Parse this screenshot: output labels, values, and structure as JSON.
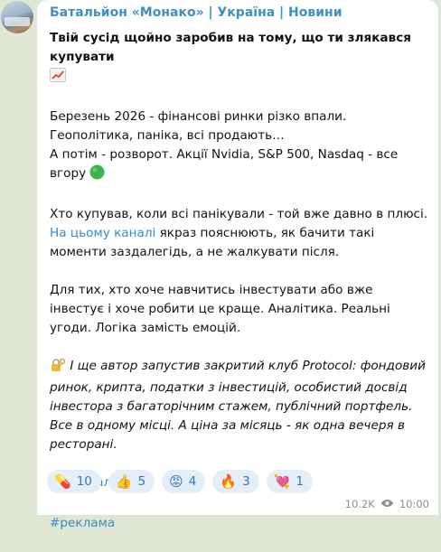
{
  "channel": {
    "name": "Батальйон «Монако» | Україна | Новини"
  },
  "post": {
    "headline": "Твій сусід щойно заробив на тому, що ти злякався купувати",
    "p1_line1": "Березень 2026 - фінансові ринки різко впали. Геополітика, паніка, всі продають…",
    "p1_line2": "А потім - розворот. Акції Nvidia, S&P 500, Nasdaq - все вгору",
    "p2_line1": "Хто купував, коли всі панікували - той вже давно в плюсі.",
    "p2_link": "На цьому каналі",
    "p2_rest": " якраз пояснюють, як бачити такі моменти заздалегідь, а не жалкувати після.",
    "p3": "Для тих, хто хоче навчитись інвестувати або вже інвестує і хоче робити це краще. Аналітика. Реальні угоди. Логіка замість емоцій.",
    "p4": " І ще автор запустив закритий клуб Protocol: фондовий ринок, крипта, податки з інвестицій, особистий досвід інвестора з багаторічним стажем, публічний портфель. Все в одному місці. А ціна за місяць - як одна вечеря в ресторані.",
    "details_link": "Деталі тут",
    "hashtag": "#реклама"
  },
  "reactions": [
    {
      "emoji": "💊",
      "icon": "pill-icon",
      "count": "10"
    },
    {
      "emoji": "👍",
      "icon": "thumbs-up-icon",
      "count": "5"
    },
    {
      "emoji": "😡",
      "icon": "angry-face-icon",
      "count": "4"
    },
    {
      "emoji": "🔥",
      "icon": "fire-icon",
      "count": "3"
    },
    {
      "emoji": "💘",
      "icon": "heart-arrow-icon",
      "count": "1"
    }
  ],
  "meta": {
    "views": "10.2K",
    "time": "10:00"
  },
  "colors": {
    "background": "#dfe7d4",
    "accent": "#3a8ac4",
    "reaction_bg": "#e3eef8"
  }
}
